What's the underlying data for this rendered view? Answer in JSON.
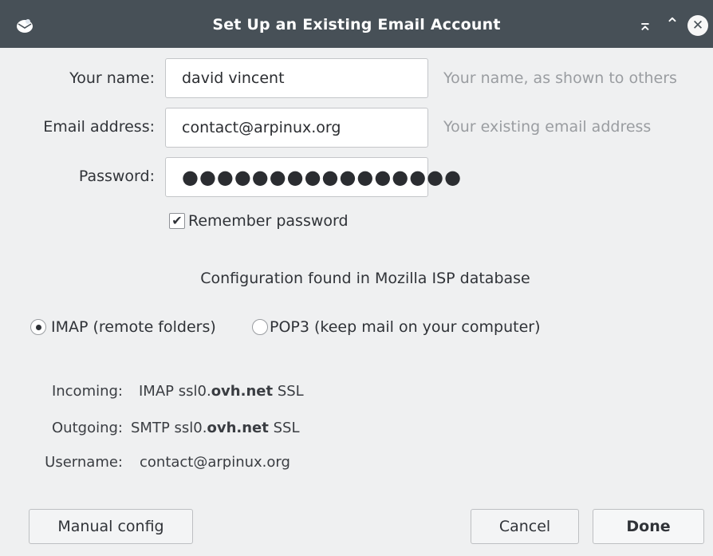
{
  "window": {
    "title": "Set Up an Existing Email Account",
    "keep_above_glyph": "⌅",
    "maximize_glyph": "⌃",
    "close_glyph": "✕"
  },
  "form": {
    "name": {
      "label": "Your name:",
      "value": "david vincent",
      "hint": "Your name, as shown to others"
    },
    "email": {
      "label": "Email address:",
      "value": "contact@arpinux.org",
      "hint": "Your existing email address"
    },
    "password": {
      "label": "Password:",
      "masked_value": "●●●●●●●●●●●●●●●●"
    },
    "remember": {
      "label": "Remember password",
      "checked": true
    }
  },
  "status_message": "Configuration found in Mozilla ISP database",
  "protocol": {
    "options": [
      {
        "label": "IMAP (remote folders)",
        "selected": true
      },
      {
        "label": "POP3 (keep mail on your computer)",
        "selected": false
      }
    ]
  },
  "server_info": {
    "incoming": {
      "label": "Incoming:",
      "protocol": "IMAP",
      "host_prefix": "ssl0.",
      "host_domain": "ovh.net",
      "security": "SSL"
    },
    "outgoing": {
      "label": "Outgoing:",
      "protocol": "SMTP",
      "host_prefix": "ssl0.",
      "host_domain": "ovh.net",
      "security": "SSL"
    },
    "username": {
      "label": "Username:",
      "value": "contact@arpinux.org"
    }
  },
  "buttons": {
    "manual_config": "Manual config",
    "cancel": "Cancel",
    "done": "Done"
  },
  "colors": {
    "titlebar": "#475057",
    "window_bg": "#eff0f1",
    "hint_text": "#9a9da1"
  }
}
